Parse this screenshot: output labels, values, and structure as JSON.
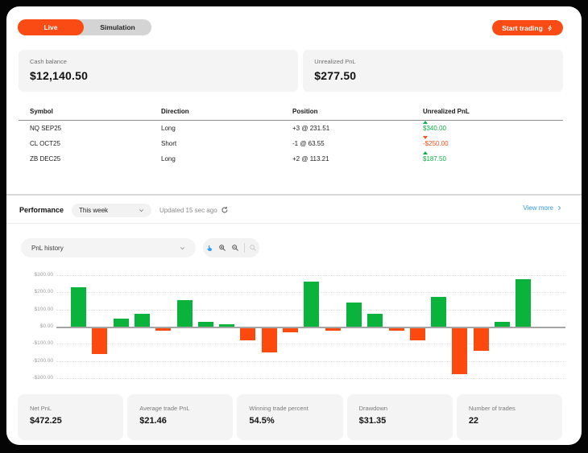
{
  "toggle": {
    "live_label": "Live",
    "simulation_label": "Simulation",
    "active": "Live"
  },
  "start_trading": {
    "label": "Start trading"
  },
  "summary_cards": [
    {
      "label": "Cash balance",
      "value": "$12,140.50"
    },
    {
      "label": "Unrealized PnL",
      "value": "$277.50"
    }
  ],
  "positions_table": {
    "columns": [
      "Symbol",
      "Direction",
      "Position",
      "Unrealized PnL"
    ],
    "rows": [
      {
        "symbol": "NQ SEP25",
        "direction": "Long",
        "position": "+3 @ 231.51",
        "pnl": "$340.00",
        "trend": "up"
      },
      {
        "symbol": "CL OCT25",
        "direction": "Short",
        "position": "-1 @ 63.55",
        "pnl": "-$250.00",
        "trend": "down"
      },
      {
        "symbol": "ZB DEC25",
        "direction": "Long",
        "position": "+2 @ 113.21",
        "pnl": "$187.50",
        "trend": "up"
      }
    ]
  },
  "performance": {
    "title": "Performance",
    "range_selected": "This week",
    "updated": "Updated 15 sec ago",
    "view_more": "View more"
  },
  "chart_controls": {
    "metric_selected": "PnL history",
    "tools": [
      "hand-tool",
      "zoom-in",
      "zoom-out",
      "reset-zoom"
    ]
  },
  "chart_data": {
    "type": "bar",
    "title": "PnL history",
    "xlabel": "",
    "ylabel": "",
    "x": [
      1,
      2,
      3,
      4,
      5,
      6,
      7,
      8,
      9,
      10,
      11,
      12,
      13,
      14,
      15,
      16,
      17,
      18,
      19,
      20,
      21,
      22
    ],
    "values": [
      232,
      -152,
      45,
      77,
      -12,
      155,
      27,
      12,
      -68,
      -140,
      -22,
      263,
      -15,
      140,
      77,
      -15,
      -68,
      175,
      -265,
      -132,
      28,
      277
    ],
    "ylim": [
      -300,
      300
    ],
    "ytick_labels": [
      "$300.00",
      "$200.00",
      "$100.00",
      "$0.00",
      "-$100.00",
      "-$200.00",
      "-$300.00"
    ],
    "grid": "horizontal-dotted",
    "legend": "none",
    "positive_color": "#0ab33c",
    "negative_color": "#fc4a0e"
  },
  "stat_cards": [
    {
      "label": "Net PnL",
      "value": "$472.25"
    },
    {
      "label": "Average trade PnL",
      "value": "$21.46"
    },
    {
      "label": "Winning trade percent",
      "value": "54.5%"
    },
    {
      "label": "Drawdown",
      "value": "$31.35"
    },
    {
      "label": "Number of trades",
      "value": "22"
    }
  ],
  "colors": {
    "accent": "#fb4b14",
    "green": "#0bb04a",
    "red": "#fc4a0e",
    "blue": "#2b97f5"
  }
}
